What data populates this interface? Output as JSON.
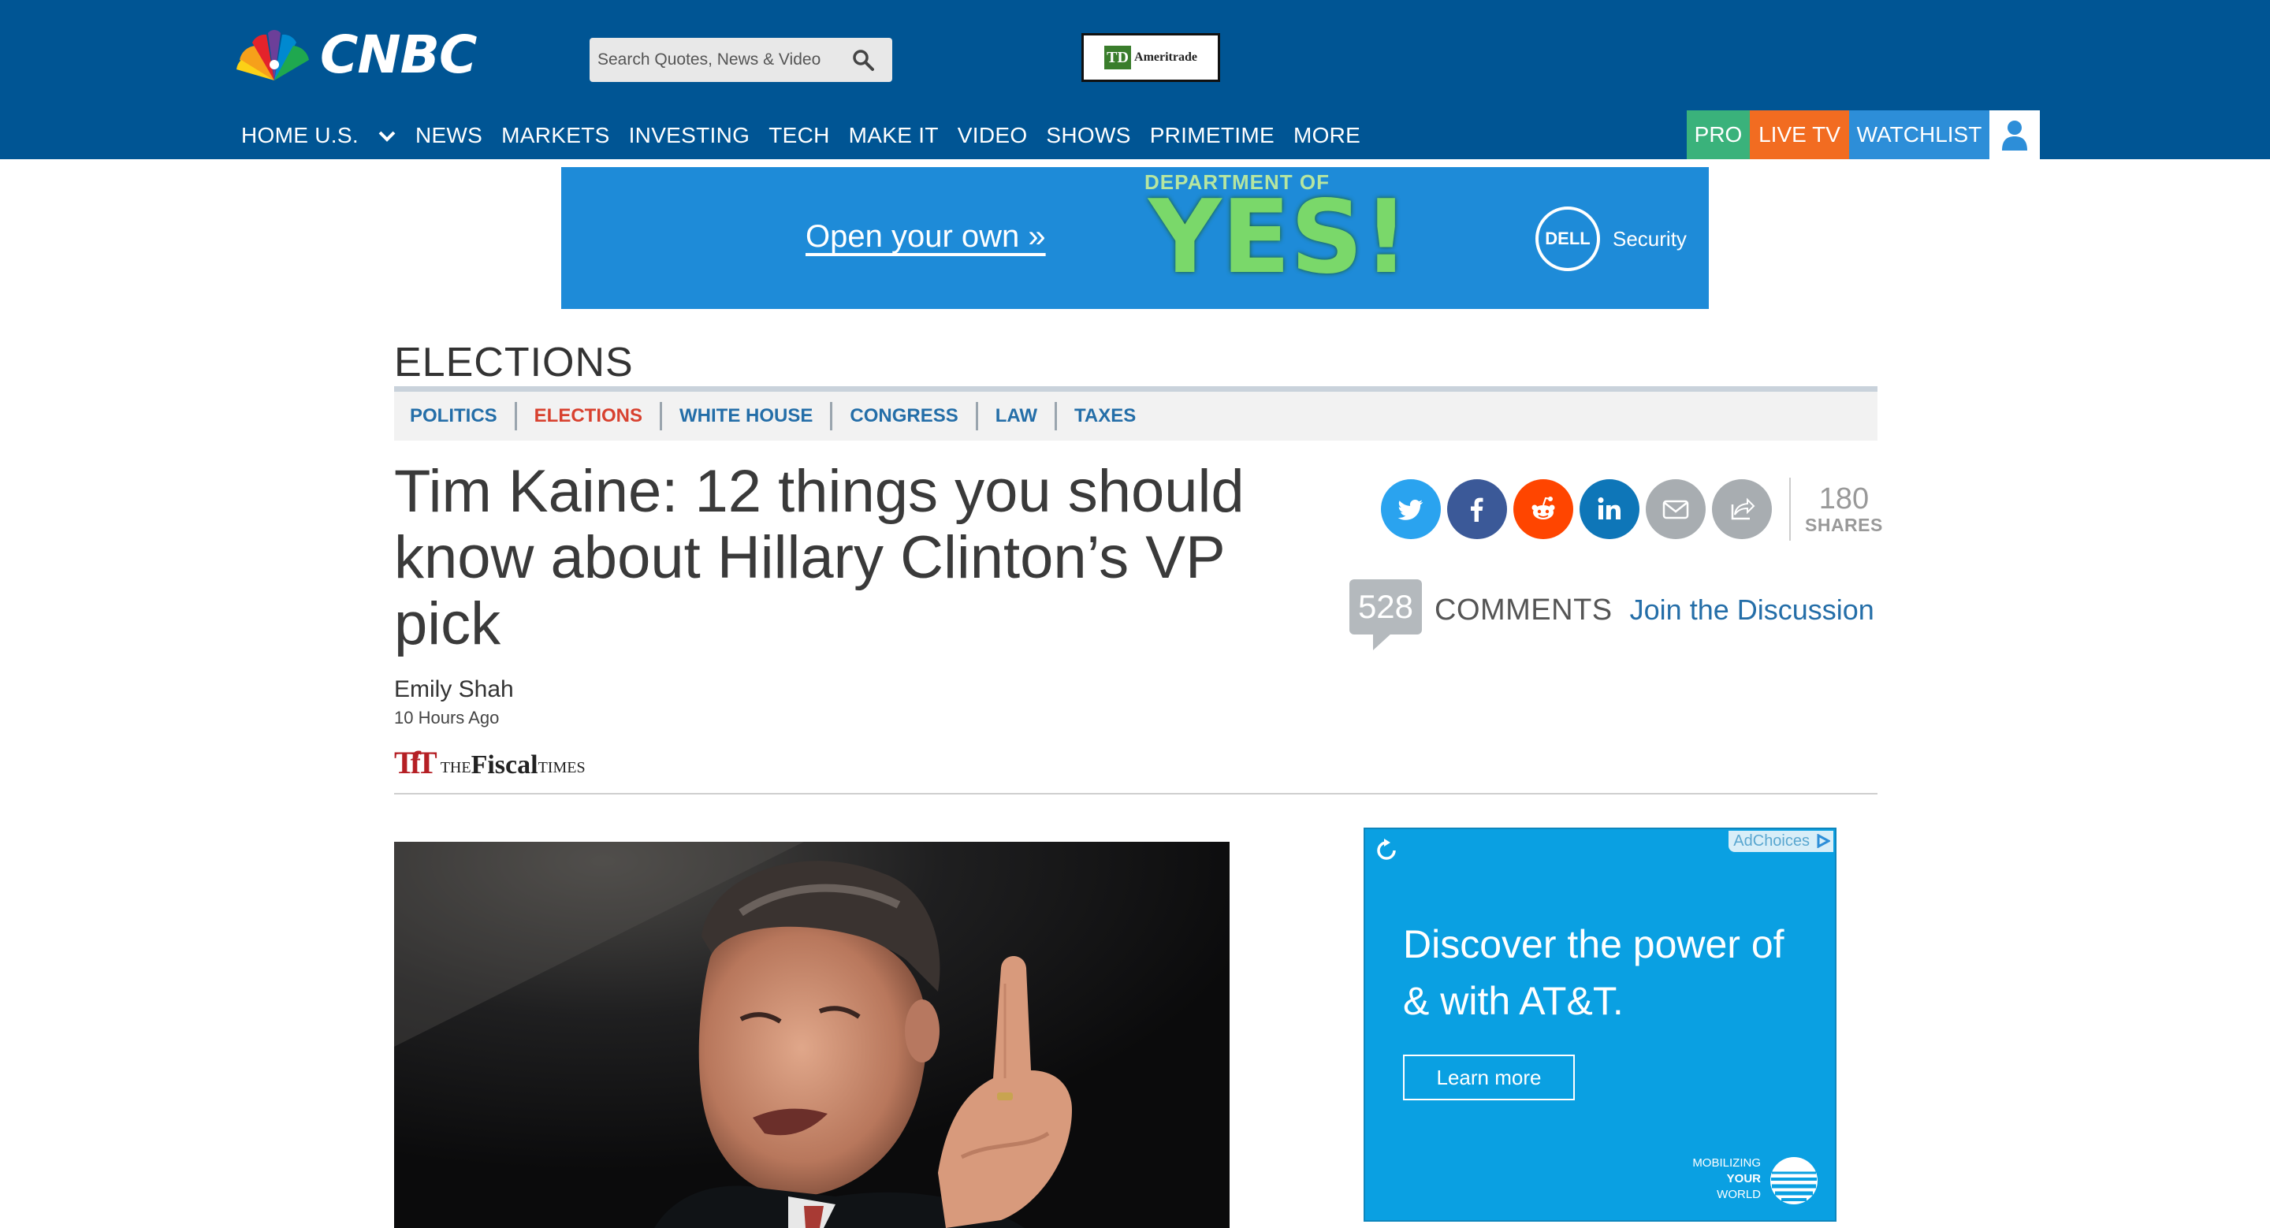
{
  "header": {
    "logo_text": "CNBC",
    "search_placeholder": "Search Quotes, News & Video",
    "sponsor_logo": "Ameritrade",
    "sponsor_mark": "TD",
    "nav": [
      "HOME U.S.",
      "NEWS",
      "MARKETS",
      "INVESTING",
      "TECH",
      "MAKE IT",
      "VIDEO",
      "SHOWS",
      "PRIMETIME",
      "MORE"
    ],
    "pro_label": "PRO",
    "live_tv_label": "LIVE TV",
    "watchlist_label": "WATCHLIST",
    "colors": {
      "bar": "#005594",
      "pro": "#3ab27b",
      "live": "#f26c21",
      "watchlist": "#2d8ed8"
    }
  },
  "banner_ad": {
    "link_text": "Open your own  »",
    "top_text": "DEPARTMENT OF",
    "big_text": "YES!",
    "brand": "DELL",
    "brand_suffix": "Security"
  },
  "section": {
    "title": "ELECTIONS",
    "subnav": [
      "POLITICS",
      "ELECTIONS",
      "WHITE HOUSE",
      "CONGRESS",
      "LAW",
      "TAXES"
    ],
    "active": "ELECTIONS"
  },
  "article": {
    "headline": "Tim Kaine: 12 things you should know about Hillary Clinton’s VP pick",
    "author": "Emily Shah",
    "time": "10 Hours Ago",
    "source_mark": "TfT",
    "source_the": "THE",
    "source_fiscal": "Fiscal",
    "source_times": "TIMES"
  },
  "share": {
    "buttons": [
      "twitter-icon",
      "facebook-icon",
      "reddit-icon",
      "linkedin-icon",
      "email-icon",
      "share-icon"
    ],
    "count": "180",
    "count_label": "SHARES"
  },
  "comments": {
    "count": "528",
    "label": "COMMENTS",
    "join": "Join the Discussion"
  },
  "side_ad": {
    "adchoices": "AdChoices",
    "headline": "Discover the power of & with AT&T.",
    "cta": "Learn more",
    "tagline_1": "MOBILIZING",
    "tagline_2": "YOUR",
    "tagline_3": "WORLD"
  }
}
